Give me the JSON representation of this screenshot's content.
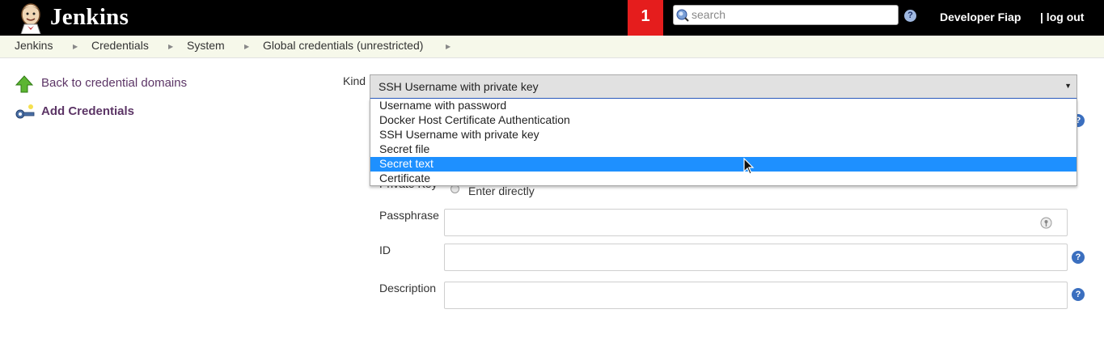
{
  "header": {
    "brand": "Jenkins",
    "notification_count": "1",
    "search_placeholder": "search",
    "help_glyph": "?",
    "user": "Developer Fiap",
    "logout": "| log out"
  },
  "breadcrumbs": [
    "Jenkins",
    "Credentials",
    "System",
    "Global credentials (unrestricted)"
  ],
  "sidebar": {
    "items": [
      {
        "label": "Back to credential domains",
        "icon": "up-arrow-icon"
      },
      {
        "label": "Add Credentials",
        "icon": "key-icon"
      }
    ]
  },
  "form": {
    "kind_label": "Kind",
    "kind_selected": "SSH Username with private key",
    "kind_options": [
      "Username with password",
      "Docker Host Certificate Authentication",
      "SSH Username with private key",
      "Secret file",
      "Secret text",
      "Certificate"
    ],
    "highlighted_option": "Secret text",
    "private_key_label": "Private Key",
    "enter_directly_label": "Enter directly",
    "passphrase_label": "Passphrase",
    "id_label": "ID",
    "description_label": "Description"
  },
  "colors": {
    "header_bg": "#000000",
    "notification_bg": "#e51d1d",
    "breadcrumb_bg": "#f6f8ea",
    "link": "#5c3566",
    "highlight": "#1e90ff"
  }
}
